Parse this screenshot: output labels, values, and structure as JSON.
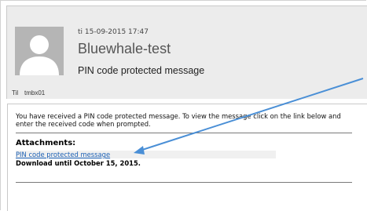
{
  "header": {
    "datetime": "ti 15-09-2015 17:47",
    "sender": "Bluewhale-test",
    "subject": "PIN code protected message",
    "to_label": "Til",
    "to_value": "tmbx01"
  },
  "body": {
    "intro": "You have received a PIN code protected message. To view the message click on the link below and enter the received code when prompted.",
    "attachments_title": "Attachments:",
    "attachment_link": "PIN code protected message",
    "download_note": "Download until October 15, 2015."
  },
  "annotation": {
    "arrow_color": "#4a8fd6"
  }
}
